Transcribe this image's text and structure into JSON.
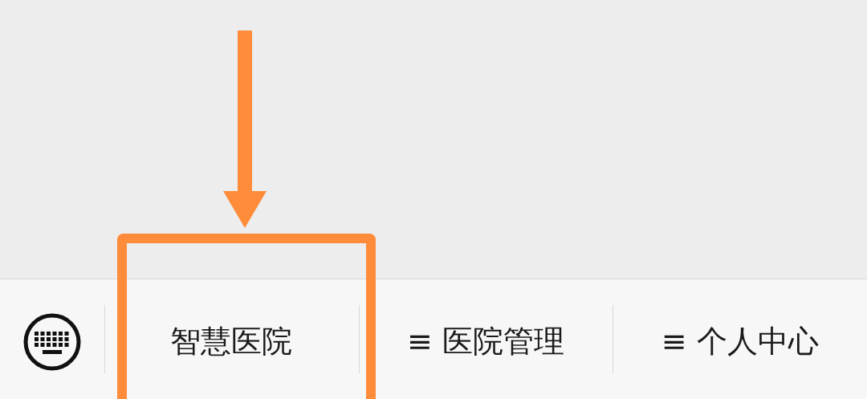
{
  "menu_bar": {
    "items": [
      {
        "label": "智慧医院",
        "highlighted": true
      },
      {
        "label": "≡ 医院管理",
        "highlighted": false
      },
      {
        "label": "≡ 个人中心",
        "highlighted": false
      }
    ]
  }
}
